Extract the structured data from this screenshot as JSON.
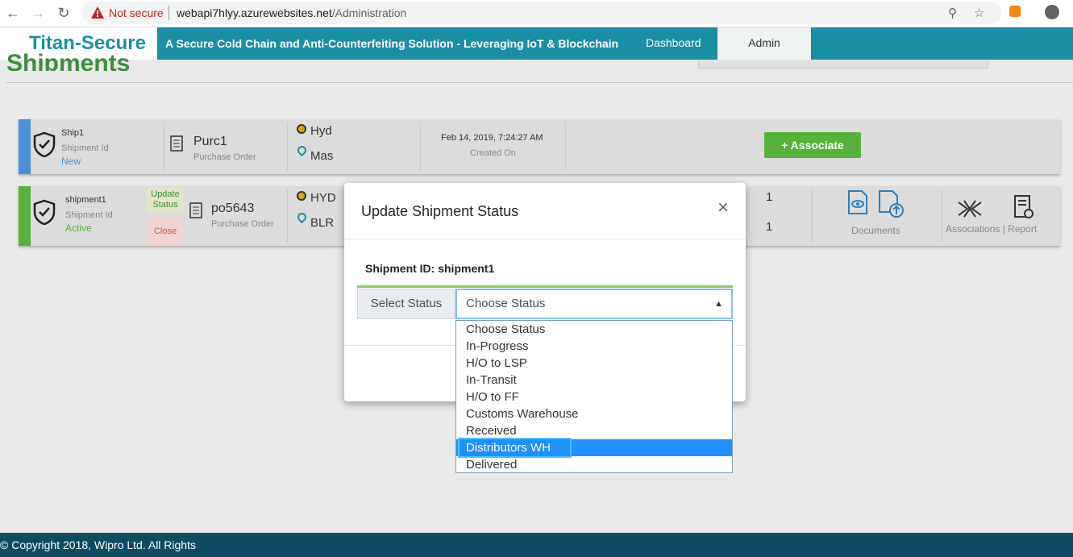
{
  "browser": {
    "not_secure": "Not secure",
    "url_host": "webapi7hlyy.azurewebsites.net",
    "url_path": "/Administration"
  },
  "header": {
    "brand": "Titan-Secure",
    "tagline": "A Secure Cold Chain and Anti-Counterfeiting Solution - Leveraging IoT & Blockchain",
    "nav_dashboard": "Dashboard",
    "nav_admin": "Admin"
  },
  "page": {
    "title": "Shipments"
  },
  "shipments": [
    {
      "id": "Ship1",
      "id_label": "Shipment Id",
      "status": "New",
      "po": "Purc1",
      "po_label": "Purchase Order",
      "from": "Hyd",
      "to": "Mas",
      "created": "Feb 14, 2019, 7:24:27 AM",
      "created_label": "Created On",
      "associate": "+ Associate"
    },
    {
      "id": "shipment1",
      "id_label": "Shipment Id",
      "status": "Active",
      "update_status": "Update Status",
      "close": "Close",
      "po": "po5643",
      "po_label": "Purchase Order",
      "from": "HYD",
      "to": "BLR",
      "count1": "1",
      "count2": "1",
      "documents": "Documents",
      "associations": "Associations | Report"
    }
  ],
  "modal": {
    "title": "Update Shipment Status",
    "close": "×",
    "shipment_id_label": "Shipment ID: shipment1",
    "select_label": "Select Status",
    "select_value": "Choose Status",
    "options": [
      "Choose Status",
      "In-Progress",
      "H/O to LSP",
      "In-Transit",
      "H/O to FF",
      "Customs Warehouse",
      "Received",
      "Distributors WH",
      "Delivered"
    ],
    "highlighted_index": 7
  },
  "footer": {
    "text": "© Copyright 2018, Wipro Ltd. All Rights"
  },
  "colors": {
    "brand": "#1a8fa6",
    "accent_green": "#56b23a",
    "status_new": "#4a90d9",
    "status_active": "#56b23a"
  }
}
